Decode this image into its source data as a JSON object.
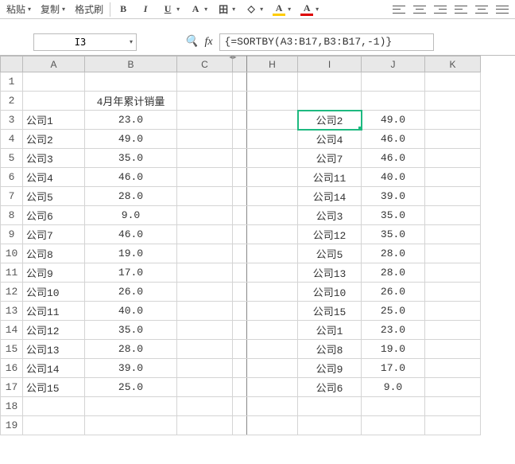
{
  "toolbar": {
    "paste": "粘贴",
    "copy": "复制",
    "format_painter": "格式刷",
    "bold": "B",
    "italic": "I",
    "underline": "U",
    "a_icon": "A",
    "fill": "◇"
  },
  "namebox": {
    "value": "I3"
  },
  "formula": {
    "text": "{=SORTBY(A3:B17,B3:B17,-1)}"
  },
  "cols": [
    "A",
    "B",
    "C",
    "H",
    "I",
    "J",
    "K"
  ],
  "rows": [
    "1",
    "2",
    "3",
    "4",
    "5",
    "6",
    "7",
    "8",
    "9",
    "10",
    "11",
    "12",
    "13",
    "14",
    "15",
    "16",
    "17",
    "18",
    "19"
  ],
  "header_b2": "4月年累计销量",
  "left_table": [
    {
      "a": "公司1",
      "b": "23.0"
    },
    {
      "a": "公司2",
      "b": "49.0"
    },
    {
      "a": "公司3",
      "b": "35.0"
    },
    {
      "a": "公司4",
      "b": "46.0"
    },
    {
      "a": "公司5",
      "b": "28.0"
    },
    {
      "a": "公司6",
      "b": "9.0"
    },
    {
      "a": "公司7",
      "b": "46.0"
    },
    {
      "a": "公司8",
      "b": "19.0"
    },
    {
      "a": "公司9",
      "b": "17.0"
    },
    {
      "a": "公司10",
      "b": "26.0"
    },
    {
      "a": "公司11",
      "b": "40.0"
    },
    {
      "a": "公司12",
      "b": "35.0"
    },
    {
      "a": "公司13",
      "b": "28.0"
    },
    {
      "a": "公司14",
      "b": "39.0"
    },
    {
      "a": "公司15",
      "b": "25.0"
    }
  ],
  "right_table": [
    {
      "i": "公司2",
      "j": "49.0"
    },
    {
      "i": "公司4",
      "j": "46.0"
    },
    {
      "i": "公司7",
      "j": "46.0"
    },
    {
      "i": "公司11",
      "j": "40.0"
    },
    {
      "i": "公司14",
      "j": "39.0"
    },
    {
      "i": "公司3",
      "j": "35.0"
    },
    {
      "i": "公司12",
      "j": "35.0"
    },
    {
      "i": "公司5",
      "j": "28.0"
    },
    {
      "i": "公司13",
      "j": "28.0"
    },
    {
      "i": "公司10",
      "j": "26.0"
    },
    {
      "i": "公司15",
      "j": "25.0"
    },
    {
      "i": "公司1",
      "j": "23.0"
    },
    {
      "i": "公司8",
      "j": "19.0"
    },
    {
      "i": "公司9",
      "j": "17.0"
    },
    {
      "i": "公司6",
      "j": "9.0"
    }
  ]
}
